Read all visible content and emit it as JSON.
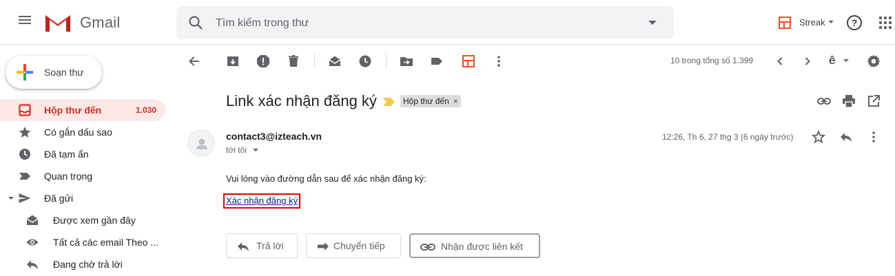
{
  "header": {
    "app_name": "Gmail",
    "search_placeholder": "Tìm kiếm trong thư",
    "streak_label": "Streak",
    "help_symbol": "?"
  },
  "sidebar": {
    "compose_label": "Soạn thư",
    "items": [
      {
        "label": "Hộp thư đến",
        "count": "1.030",
        "icon": "inbox-icon",
        "active": true
      },
      {
        "label": "Có gắn dấu sao",
        "icon": "star-icon"
      },
      {
        "label": "Đã tạm ẩn",
        "icon": "clock-icon"
      },
      {
        "label": "Quan trọng",
        "icon": "important-label-icon"
      },
      {
        "label": "Đã gửi",
        "icon": "send-icon"
      },
      {
        "label": "Được xem gần đây",
        "icon": "open-envelope-icon"
      },
      {
        "label": "Tất cả các email Theo ...",
        "icon": "eye-icon"
      },
      {
        "label": "Đang chờ trả lời",
        "icon": "reply-icon"
      }
    ]
  },
  "toolbar": {
    "pager_text": "10 trong tổng số 1.399",
    "input_tool_label": "ê"
  },
  "email": {
    "subject": "Link xác nhận đăng ký",
    "label_chip": "Hộp thư đến",
    "label_chip_close": "×",
    "sender": "contact3@izteach.vn",
    "recipient": "tới tôi",
    "datetime": "12:26, Th 6, 27 thg 3 (6 ngày trước)",
    "body_text": "Vui lòng vào đường dẫn sau để xác nhận đăng ký:",
    "link_text": "Xác nhận đăng ký"
  },
  "actions": {
    "reply_label": "Trả lời",
    "forward_label": "Chuyển tiếp",
    "link_label": "Nhận được liên kết"
  },
  "colors": {
    "accent_red": "#d93025",
    "streak_orange": "#f4511e",
    "label_yellow": "#f2c94c",
    "highlight_box": "#ee0000"
  }
}
